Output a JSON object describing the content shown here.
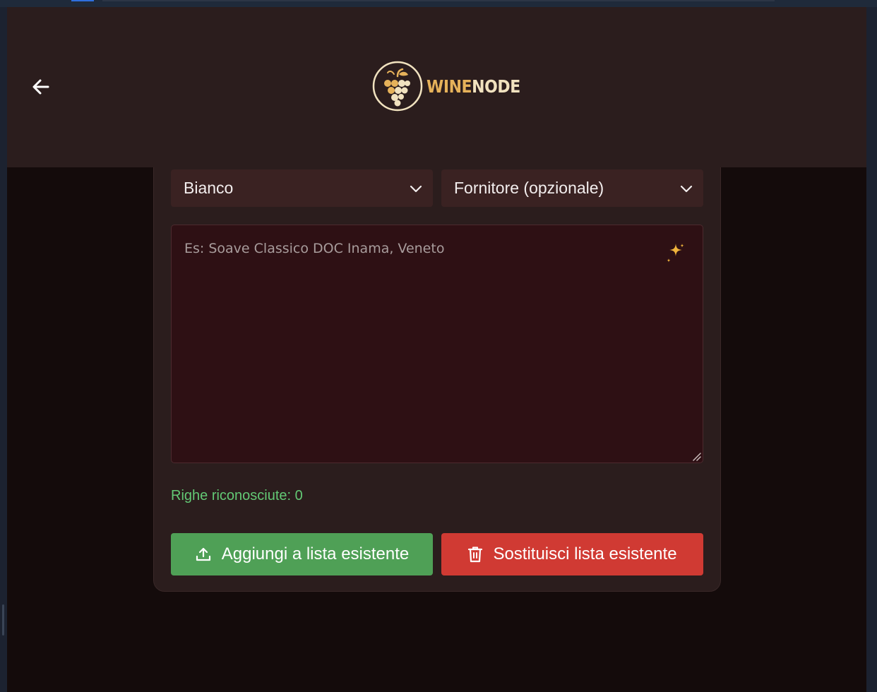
{
  "header": {
    "back_icon": "arrow-left-icon",
    "logo": {
      "icon": "grapes-icon",
      "wordmark_part1": "WINE",
      "wordmark_part2": "NODE"
    }
  },
  "form": {
    "wine_type": {
      "value": "Bianco",
      "icon": "chevron-down-icon"
    },
    "supplier": {
      "value": "Fornitore (opzionale)",
      "icon": "chevron-down-icon"
    },
    "wine_list_input": {
      "value": "",
      "placeholder": "Es: Soave Classico DOC Inama, Veneto",
      "action_icon": "sparkles-icon"
    },
    "recognized_rows_label": "Righe riconosciute: 0",
    "add_button": {
      "label": "Aggiungi a lista esistente",
      "icon": "upload-icon"
    },
    "replace_button": {
      "label": "Sostituisci lista esistente",
      "icon": "trash-icon"
    }
  },
  "colors": {
    "background": "#140b0b",
    "surface": "#2b1d1d",
    "select_bg": "#3a2222",
    "textarea_bg": "#2e1014",
    "accent_gold": "#e6b25a",
    "success_green": "#4fa056",
    "danger_red": "#d03a33",
    "count_green": "#63c975"
  }
}
